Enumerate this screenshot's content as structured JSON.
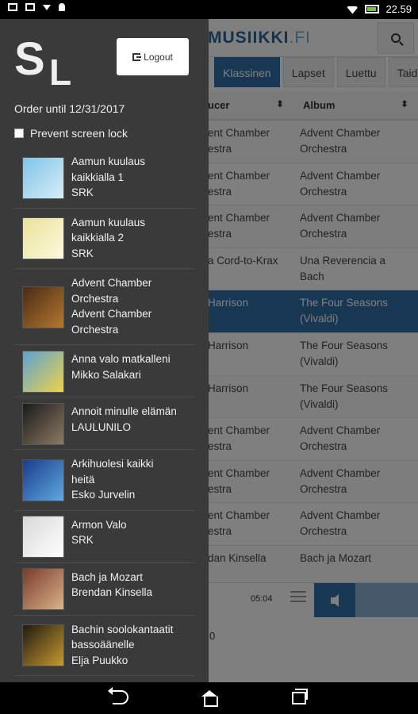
{
  "status_bar": {
    "time": "22.59",
    "icons": [
      "notification-icon",
      "image-icon",
      "download-icon",
      "lightbulb-icon",
      "wifi-icon",
      "battery-icon"
    ]
  },
  "app": {
    "brand": "MUSIIKKI",
    "brand_suffix": ".FI",
    "tabs": [
      {
        "label": "Klassinen",
        "active": true
      },
      {
        "label": "Lapset",
        "active": false
      },
      {
        "label": "Luettu",
        "active": false
      },
      {
        "label": "Taide",
        "active": false
      }
    ],
    "columns": {
      "producer": "ucer",
      "album": "Album"
    },
    "rows": [
      {
        "producer": "ent Chamber\nestra",
        "album": "Advent Chamber\nOrchestra",
        "selected": false
      },
      {
        "producer": "ent Chamber\nestra",
        "album": "Advent Chamber\nOrchestra",
        "selected": false
      },
      {
        "producer": "ent Chamber\nestra",
        "album": "Advent Chamber\nOrchestra",
        "selected": false
      },
      {
        "producer": "a Cord-to-Krax",
        "album": "Una Reverencia a\nBach",
        "selected": false
      },
      {
        "producer": "Harrison",
        "album": "The Four Seasons\n(Vivaldi)",
        "selected": true
      },
      {
        "producer": "Harrison",
        "album": "The Four Seasons\n(Vivaldi)",
        "selected": false
      },
      {
        "producer": "Harrison",
        "album": "The Four Seasons\n(Vivaldi)",
        "selected": false
      },
      {
        "producer": "ent Chamber\nestra",
        "album": "Advent Chamber\nOrchestra",
        "selected": false
      },
      {
        "producer": "ent Chamber\nestra",
        "album": "Advent Chamber\nOrchestra",
        "selected": false
      },
      {
        "producer": "ent Chamber\nestra",
        "album": "Advent Chamber\nOrchestra",
        "selected": false
      },
      {
        "producer": "dan Kinsella",
        "album": "Bach ja Mozart",
        "selected": false
      }
    ],
    "player": {
      "duration": "05:04",
      "counter": "0"
    }
  },
  "drawer": {
    "logo": {
      "s": "S",
      "l": "L"
    },
    "logout_label": "Logout",
    "order_text": "Order until 12/31/2017",
    "screen_lock_label": "Prevent screen lock",
    "items": [
      {
        "lines": [
          "Aamun kuulaus",
          "kaikkialla 1",
          "SRK"
        ],
        "colors": [
          "#7fc3e8",
          "#d8eef8"
        ]
      },
      {
        "lines": [
          "Aamun kuulaus",
          "kaikkialla 2",
          "SRK"
        ],
        "colors": [
          "#e9e39a",
          "#fbf9de"
        ]
      },
      {
        "lines": [
          "Advent Chamber",
          "Orchestra",
          "Advent Chamber",
          "Orchestra"
        ],
        "colors": [
          "#4a2a14",
          "#b5782e"
        ]
      },
      {
        "lines": [
          "Anna valo matkalleni",
          "Mikko Salakari"
        ],
        "colors": [
          "#5aa3d1",
          "#f0d24a"
        ]
      },
      {
        "lines": [
          "Annoit minulle elämän",
          "LAULUNILO"
        ],
        "colors": [
          "#1a1a1a",
          "#8c7a62"
        ]
      },
      {
        "lines": [
          "Arkihuolesi kaikki",
          "heitä",
          "Esko Jurvelin"
        ],
        "colors": [
          "#1a3c8c",
          "#5fa9e0"
        ]
      },
      {
        "lines": [
          "Armon Valo",
          "SRK"
        ],
        "colors": [
          "#d8d8d8",
          "#ffffff"
        ]
      },
      {
        "lines": [
          "Bach ja Mozart",
          "Brendan Kinsella"
        ],
        "colors": [
          "#7a3a2a",
          "#d9b48a"
        ]
      },
      {
        "lines": [
          "Bachin soolokantaatit",
          "bassoäänelle",
          "Elja Puukko"
        ],
        "colors": [
          "#1e1a10",
          "#c99a2e"
        ]
      }
    ]
  }
}
